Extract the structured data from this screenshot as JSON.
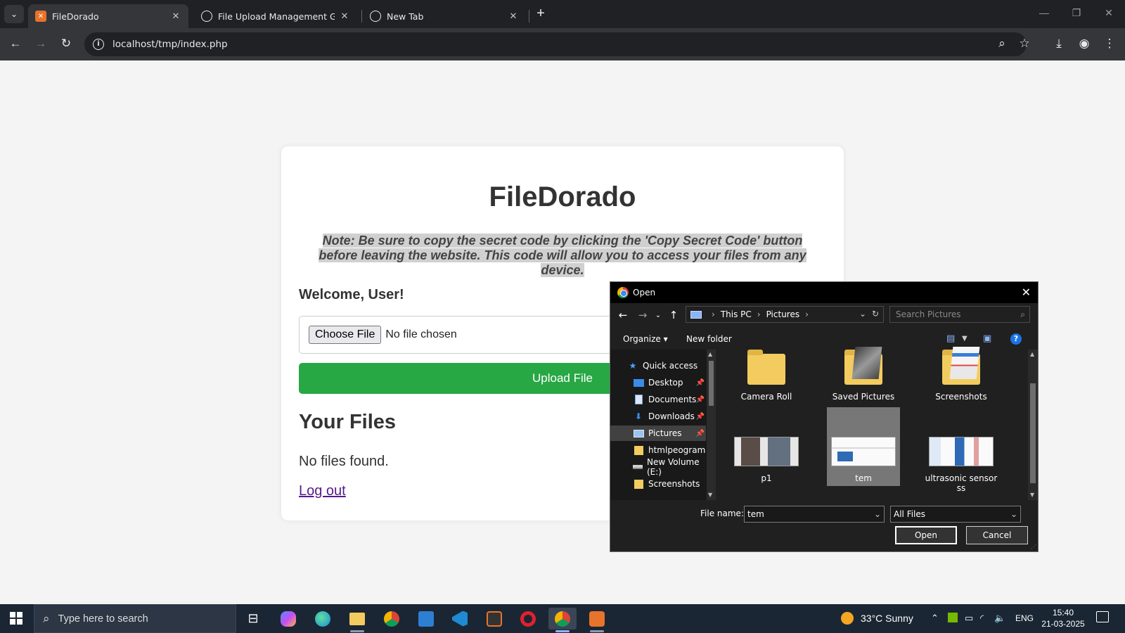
{
  "browser": {
    "tabs": [
      {
        "title": "FileDorado",
        "active": true
      },
      {
        "title": "File Upload Management Guide",
        "active": false
      },
      {
        "title": "New Tab",
        "active": false
      }
    ],
    "address": "localhost/tmp/index.php"
  },
  "page": {
    "app_title": "FileDorado",
    "note": "Note: Be sure to copy the secret code by clicking the 'Copy Secret Code' button before leaving the website. This code will allow you to access your files from any device.",
    "welcome": "Welcome, User!",
    "choose_file_label": "Choose File",
    "no_file_chosen": "No file chosen",
    "upload_label": "Upload File",
    "files_heading": "Your Files",
    "no_files": "No files found.",
    "logout_label": "Log out",
    "upload_color": "#28a745"
  },
  "dialog": {
    "title": "Open",
    "breadcrumb": [
      "This PC",
      "Pictures"
    ],
    "search_placeholder": "Search Pictures",
    "organize_label": "Organize",
    "new_folder_label": "New folder",
    "nav_items": [
      {
        "label": "Quick access",
        "icon": "star-icon"
      },
      {
        "label": "Desktop",
        "icon": "desktop-icon",
        "pinned": true
      },
      {
        "label": "Documents",
        "icon": "documents-icon",
        "pinned": true
      },
      {
        "label": "Downloads",
        "icon": "download-icon",
        "pinned": true
      },
      {
        "label": "Pictures",
        "icon": "pictures-icon",
        "pinned": true,
        "selected": true
      },
      {
        "label": "htmlpeogram",
        "icon": "folder-icon"
      },
      {
        "label": "New Volume (E:)",
        "icon": "drive-icon"
      },
      {
        "label": "Screenshots",
        "icon": "folder-icon"
      }
    ],
    "items": [
      {
        "label": "Camera Roll",
        "kind": "folder"
      },
      {
        "label": "Saved Pictures",
        "kind": "folder"
      },
      {
        "label": "Screenshots",
        "kind": "folder"
      },
      {
        "label": "p1",
        "kind": "image"
      },
      {
        "label": "tem",
        "kind": "image",
        "selected": true
      },
      {
        "label": "ultrasonic sensor ss",
        "kind": "image"
      }
    ],
    "file_name_label": "File name:",
    "file_name_value": "tem",
    "file_type": "All Files",
    "open_label": "Open",
    "cancel_label": "Cancel"
  },
  "taskbar": {
    "search_placeholder": "Type here to search",
    "weather": "33°C  Sunny",
    "language": "ENG",
    "time": "15:40",
    "date": "21-03-2025"
  }
}
